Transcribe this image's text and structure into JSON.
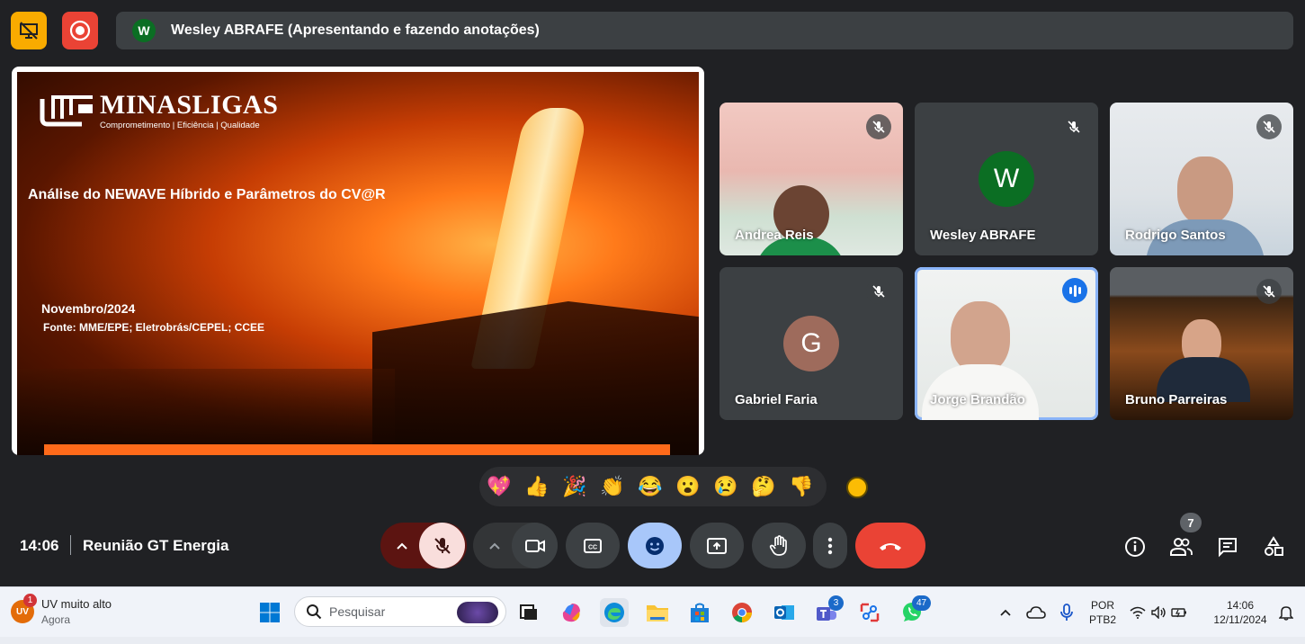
{
  "presenter": {
    "initial": "W",
    "label": "Wesley ABRAFE (Apresentando e fazendo anotações)"
  },
  "slide": {
    "brand": "MINASLIGAS",
    "tagline": "Comprometimento | Eficiência | Qualidade",
    "title": "Análise do NEWAVE Híbrido e Parâmetros do CV@R",
    "date": "Novembro/2024",
    "source": "Fonte: MME/EPE; Eletrobrás/CEPEL; CCEE"
  },
  "participants": [
    {
      "name": "Andrea Reis",
      "muted": true,
      "video": true
    },
    {
      "name": "Wesley ABRAFE",
      "initial": "W",
      "avatar_color": "#0b6e23",
      "muted": true,
      "video": false
    },
    {
      "name": "Rodrigo Santos",
      "muted": true,
      "video": true
    },
    {
      "name": "Gabriel Faria",
      "initial": "G",
      "avatar_color": "#9e6b5c",
      "muted": true,
      "video": false
    },
    {
      "name": "Jorge Brandão",
      "muted": false,
      "speaking": true,
      "video": true
    },
    {
      "name": "Bruno Parreiras",
      "muted": true,
      "video": true
    }
  ],
  "reactions": [
    "💖",
    "👍",
    "🎉",
    "👏",
    "😂",
    "😮",
    "😢",
    "🤔",
    "👎"
  ],
  "meeting": {
    "time": "14:06",
    "title": "Reunião GT Energia",
    "people_count": "7"
  },
  "colors": {
    "background": "#202124",
    "hangup": "#ea4335",
    "mic_off": "#f9dedc",
    "reactions_active": "#a8c7fa",
    "speaking": "#1a73e8"
  },
  "taskbar": {
    "notification_title": "UV muito alto",
    "notification_sub": "Agora",
    "notification_count": "1",
    "notification_icon_text": "UV",
    "search_placeholder": "Pesquisar",
    "teams_badge": "3",
    "whatsapp_badge": "47",
    "lang_top": "POR",
    "lang_bottom": "PTB2",
    "clock_time": "14:06",
    "clock_date": "12/11/2024"
  }
}
